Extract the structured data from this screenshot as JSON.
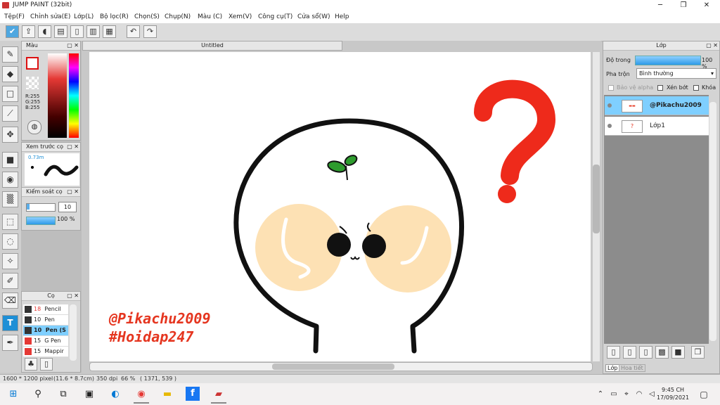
{
  "window": {
    "title": "JUMP PAINT (32bit)",
    "minimize": "─",
    "maximize": "❐",
    "close": "✕"
  },
  "menu": [
    "Tệp(F)",
    "Chỉnh sửa(E)",
    "Lớp(L)",
    "Bộ lọc(R)",
    "Chọn(S)",
    "Chụp(N)",
    "Màu (C)",
    "Xem(V)",
    "Công cụ(T)",
    "Cửa sổ(W)",
    "Help"
  ],
  "color_panel": {
    "title": "Màu",
    "r": "R:255",
    "g": "G:255",
    "b": "B:255"
  },
  "preview_panel": {
    "title": "Xem trước cọ",
    "size": "0.73m"
  },
  "control_panel": {
    "title": "Kiểm soát cọ",
    "size_value": "10",
    "opacity_value": "100 %"
  },
  "brush_panel": {
    "title": "Cọ",
    "items": [
      {
        "size": "18",
        "name": "Pencil",
        "color": "#333333"
      },
      {
        "size": "10",
        "name": "Pen",
        "color": "#333333"
      },
      {
        "size": "10",
        "name": "Pen (S",
        "color": "#333333"
      },
      {
        "size": "15",
        "name": "G Pen",
        "color": "#e53935"
      },
      {
        "size": "15",
        "name": "Mappir",
        "color": "#e53935"
      }
    ]
  },
  "document": {
    "tab": "Untitled",
    "watermark_line1": "@Pikachu2009",
    "watermark_line2": "#Hoidap247"
  },
  "layer_panel": {
    "title": "Lớp",
    "opacity_label": "Độ trong",
    "opacity_value": "100 %",
    "blend_label": "Pha trộn",
    "blend_value": "Bình thường",
    "protect_alpha": "Bảo vệ alpha",
    "clip": "Xén bớt",
    "lock": "Khóa",
    "layers": [
      {
        "name": "@Pikachu2009",
        "selected": true
      },
      {
        "name": "Lớp1",
        "selected": false
      }
    ],
    "tab_layer": "Lớp",
    "tab_texture": "Hoa tiết"
  },
  "status": {
    "size": "1600 * 1200 pixel",
    "cm": "(11.6 * 8.7cm)",
    "dpi": "350 dpi",
    "zoom": "66 %",
    "coords": "( 1371, 539 )"
  },
  "taskbar": {
    "time": "9:45 CH",
    "date": "17/09/2021"
  },
  "colors": {
    "accent": "#1e8fd6",
    "question": "#ee2a1b",
    "cheek": "#fde1b4",
    "watermark": "#e53620"
  }
}
